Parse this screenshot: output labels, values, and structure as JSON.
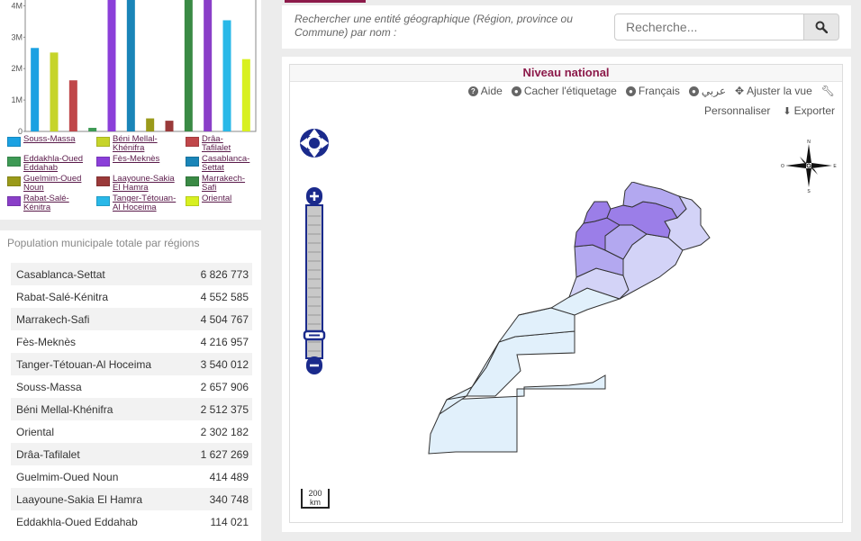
{
  "chart_data": {
    "type": "bar",
    "y_tick_labels": [
      "0",
      "1M",
      "2M",
      "3M",
      "4M"
    ],
    "ylim": [
      0,
      4300000
    ],
    "series": [
      {
        "name": "Souss-Massa",
        "value": 2657906,
        "color": "#1ba1e2"
      },
      {
        "name": "Béni Mellal-Khénifra",
        "value": 2512375,
        "color": "#c6d42a"
      },
      {
        "name": "Drâa-Tafilalet",
        "value": 1627269,
        "color": "#c0474a"
      },
      {
        "name": "Eddakhla-Oued Eddahab",
        "value": 114021,
        "color": "#3e9a55"
      },
      {
        "name": "Fès-Meknès",
        "value": 4216957,
        "color": "#8b3fd9"
      },
      {
        "name": "Casablanca-Settat",
        "value": 6826773,
        "color": "#1a85b8"
      },
      {
        "name": "Guelmim-Oued Noun",
        "value": 414489,
        "color": "#9a9a1a"
      },
      {
        "name": "Laayoune-Sakia El Hamra",
        "value": 340748,
        "color": "#9a3a3a"
      },
      {
        "name": "Marrakech-Safi",
        "value": 4504767,
        "color": "#3a8a45"
      },
      {
        "name": "Rabat-Salé-Kénitra",
        "value": 4552585,
        "color": "#8a3fc8"
      },
      {
        "name": "Tanger-Tétouan-Al Hoceima",
        "value": 3540012,
        "color": "#29b8e8"
      },
      {
        "name": "Oriental",
        "value": 2302182,
        "color": "#d8f020"
      }
    ],
    "legend_order": [
      "Souss-Massa",
      "Béni Mellal-Khénifra",
      "Drâa-Tafilalet",
      "Eddakhla-Oued Eddahab",
      "Fès-Meknès",
      "Casablanca-Settat",
      "Guelmim-Oued Noun",
      "Laayoune-Sakia El Hamra",
      "Marrakech-Safi",
      "Rabat-Salé-Kénitra",
      "Tanger-Tétouan-Al Hoceima",
      "Oriental"
    ]
  },
  "legend": {
    "items": [
      {
        "label_l1": "Souss-Massa",
        "label_l2": "",
        "color": "#1ba1e2"
      },
      {
        "label_l1": "Béni Mellal-",
        "label_l2": "Khénifra",
        "color": "#c6d42a"
      },
      {
        "label_l1": "Drâa-",
        "label_l2": "Tafilalet",
        "color": "#c0474a"
      },
      {
        "label_l1": "Eddakhla-Oued",
        "label_l2": "Eddahab",
        "color": "#3e9a55"
      },
      {
        "label_l1": "Fès-Meknès",
        "label_l2": "",
        "color": "#8b3fd9"
      },
      {
        "label_l1": "Casablanca-",
        "label_l2": "Settat",
        "color": "#1a85b8"
      },
      {
        "label_l1": "Guelmim-Oued",
        "label_l2": "Noun",
        "color": "#9a9a1a"
      },
      {
        "label_l1": "Laayoune-Sakia",
        "label_l2": "El Hamra",
        "color": "#9a3a3a"
      },
      {
        "label_l1": "Marrakech-",
        "label_l2": "Safi",
        "color": "#3a8a45"
      },
      {
        "label_l1": "Rabat-Salé-",
        "label_l2": "Kénitra",
        "color": "#8a3fc8"
      },
      {
        "label_l1": "Tanger-Tétouan-",
        "label_l2": "Al Hoceima",
        "color": "#29b8e8"
      },
      {
        "label_l1": "Oriental",
        "label_l2": "",
        "color": "#d8f020"
      }
    ]
  },
  "table": {
    "title": "Population municipale totale par régions",
    "rows": [
      {
        "region": "Casablanca-Settat",
        "value": "6 826 773"
      },
      {
        "region": "Rabat-Salé-Kénitra",
        "value": "4 552 585"
      },
      {
        "region": "Marrakech-Safi",
        "value": "4 504 767"
      },
      {
        "region": "Fès-Meknès",
        "value": "4 216 957"
      },
      {
        "region": "Tanger-Tétouan-Al Hoceima",
        "value": "3 540 012"
      },
      {
        "region": "Souss-Massa",
        "value": "2 657 906"
      },
      {
        "region": "Béni Mellal-Khénifra",
        "value": "2 512 375"
      },
      {
        "region": "Oriental",
        "value": "2 302 182"
      },
      {
        "region": "Drâa-Tafilalet",
        "value": "1 627 269"
      },
      {
        "region": "Guelmim-Oued Noun",
        "value": "414 489"
      },
      {
        "region": "Laayoune-Sakia El Hamra",
        "value": "340 748"
      },
      {
        "region": "Eddakhla-Oued Eddahab",
        "value": "114 021"
      }
    ]
  },
  "search": {
    "label": "Rechercher une entité géographique (Région, province ou Commune) par nom :",
    "placeholder": "Recherche...",
    "button_icon": "search-icon"
  },
  "map": {
    "title": "Niveau national",
    "toolbar": {
      "help": "Aide",
      "hide_labels": "Cacher l'étiquetage",
      "lang_fr": "Français",
      "lang_ar": "عربي",
      "fit_view": "Ajuster la vue",
      "customize": "Personnaliser",
      "export": "Exporter"
    },
    "scale_value": "200",
    "scale_unit": "km",
    "compass_n": "N",
    "compass_s": "S",
    "compass_e": "E",
    "compass_o": "O",
    "colors": {
      "nav": "#1a2a8c",
      "region_dark": "#9b7ee8",
      "region_mid": "#b3a8f0",
      "region_light": "#d3d3f7",
      "region_pale": "#e1f0fb"
    }
  }
}
